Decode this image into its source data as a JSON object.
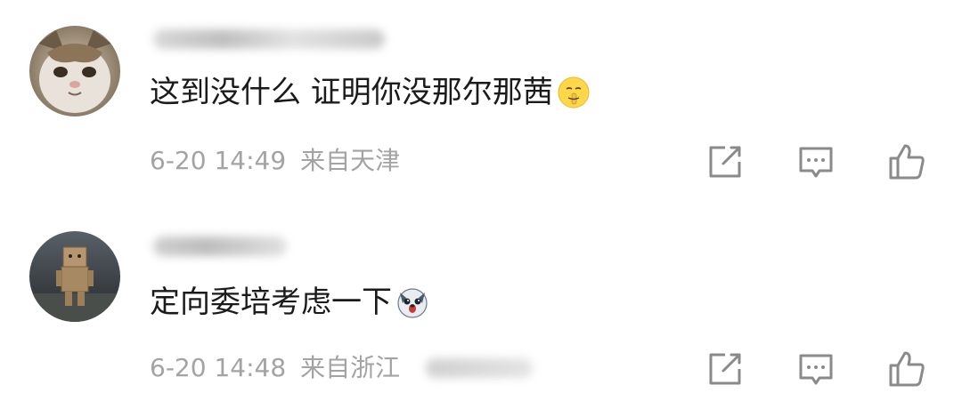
{
  "comments": [
    {
      "text": "这到没什么 证明你没那尔那茜",
      "emoji": "shushing-face-emoji",
      "time": "6-20 14:49",
      "location": "来自天津",
      "avatar": "cat-avatar"
    },
    {
      "text": "定向委培考虑一下",
      "emoji": "surprised-dog-emoji",
      "time": "6-20 14:48",
      "location": "来自浙江",
      "avatar": "cardboard-robot-avatar"
    }
  ],
  "actions": [
    "share-icon",
    "comment-icon",
    "like-icon"
  ],
  "colors": {
    "text": "#1a1a1a",
    "meta": "#a3a3a3",
    "icon": "#8a8a8a"
  }
}
